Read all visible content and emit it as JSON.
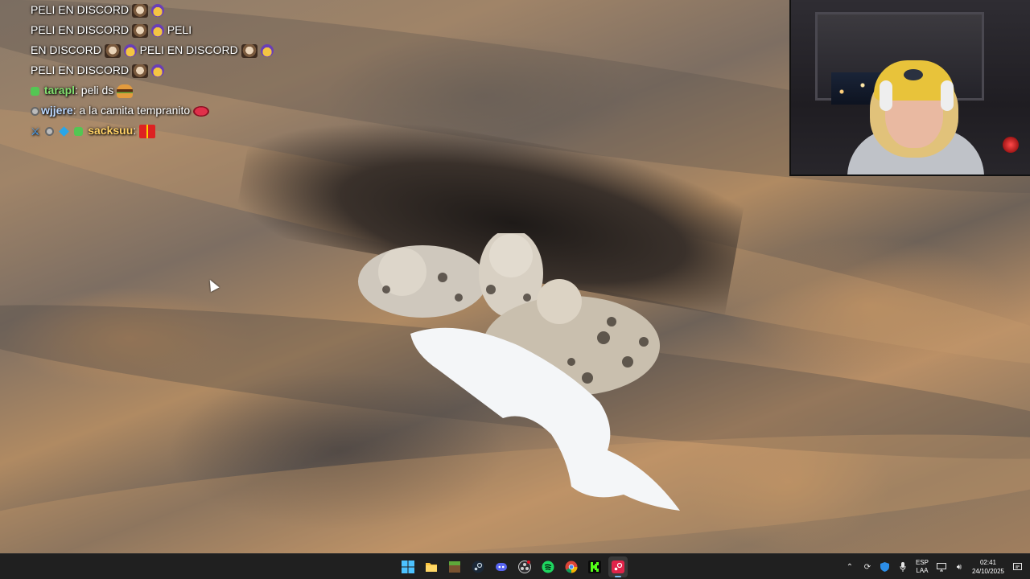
{
  "chat": {
    "lines": [
      {
        "segments": [
          "PELI EN DISCORD",
          "PELI EN DISCORD",
          "PELI",
          "EN DISCORD",
          "PELI EN DISCORD",
          "PELI EN DISCORD"
        ]
      },
      {
        "username": "tarapl",
        "message": ": peli ds"
      },
      {
        "username": "wjjere",
        "message": ": a la camita tempranito"
      },
      {
        "username": "sacksuu",
        "message": ":"
      }
    ]
  },
  "taskbar": {
    "apps": [
      {
        "name": "windows-start",
        "label": "Start"
      },
      {
        "name": "file-explorer",
        "label": "File Explorer"
      },
      {
        "name": "minecraft",
        "label": "Minecraft"
      },
      {
        "name": "steam",
        "label": "Steam"
      },
      {
        "name": "discord",
        "label": "Discord"
      },
      {
        "name": "obs",
        "label": "OBS"
      },
      {
        "name": "spotify",
        "label": "Spotify"
      },
      {
        "name": "chrome",
        "label": "Chrome"
      },
      {
        "name": "kick",
        "label": "Kick"
      },
      {
        "name": "steam-active",
        "label": "Steam"
      }
    ],
    "tray": {
      "lang_line1": "ESP",
      "lang_line2": "LAA",
      "time": "02:41",
      "date": "24/10/2025"
    }
  },
  "colors": {
    "taskbar_bg": "#202020",
    "accent": "#76b9ed"
  }
}
